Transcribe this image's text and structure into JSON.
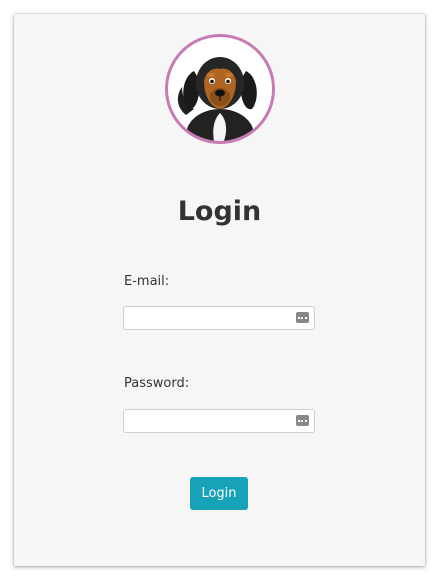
{
  "page": {
    "title": "Login"
  },
  "avatar": {
    "icon": "dog-avatar-icon",
    "border_color": "#c87ab4"
  },
  "form": {
    "email_label": "E-mail:",
    "email_value": "",
    "password_label": "Password:",
    "password_value": "",
    "field_icon": "password-manager-key-icon",
    "submit_label": "Login",
    "submit_color": "#17a2b8"
  }
}
